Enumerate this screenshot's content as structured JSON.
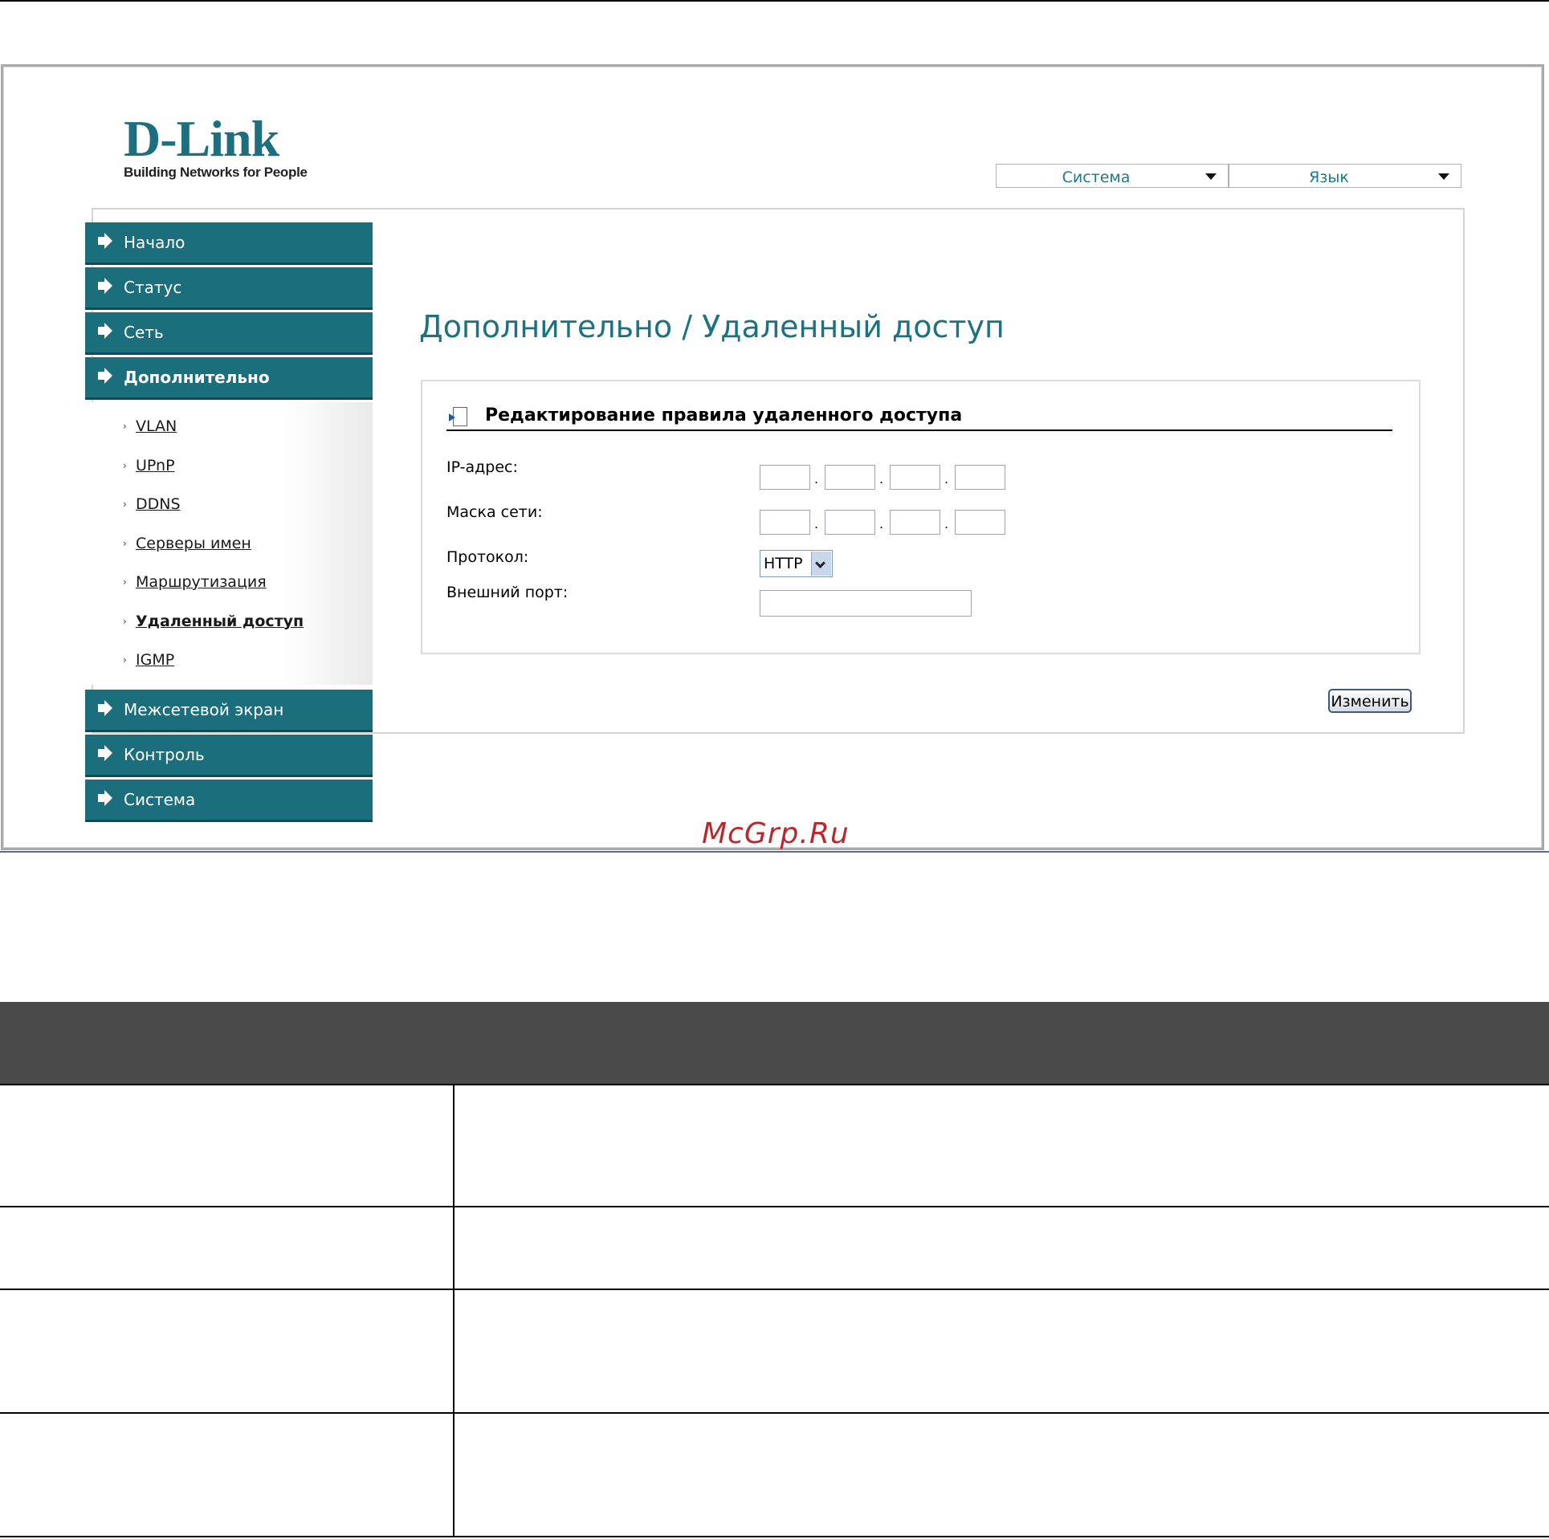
{
  "logo": {
    "main": "D-Link",
    "tagline": "Building Networks for People"
  },
  "topmenu": {
    "system": "Система",
    "language": "Язык"
  },
  "sidebar": {
    "items": [
      {
        "label": "Начало"
      },
      {
        "label": "Статус"
      },
      {
        "label": "Сеть"
      },
      {
        "label": "Дополнительно"
      }
    ],
    "submenu": [
      "VLAN",
      "UPnP",
      "DDNS",
      "Серверы имен",
      "Маршрутизация",
      "Удаленный доступ",
      "IGMP"
    ],
    "items_after": [
      {
        "label": "Межсетевой экран"
      },
      {
        "label": "Контроль"
      },
      {
        "label": "Система"
      }
    ]
  },
  "page": {
    "title": "Дополнительно / Удаленный доступ",
    "section_title": "Редактирование правила удаленного доступа",
    "labels": {
      "ip": "IP-адрес:",
      "mask": "Маска сети:",
      "protocol": "Протокол:",
      "port": "Внешний порт:"
    },
    "protocol_value": "HTTP",
    "port_value": "",
    "apply": "Изменить",
    "ip_sep": "."
  },
  "watermark": "McGrp.Ru"
}
